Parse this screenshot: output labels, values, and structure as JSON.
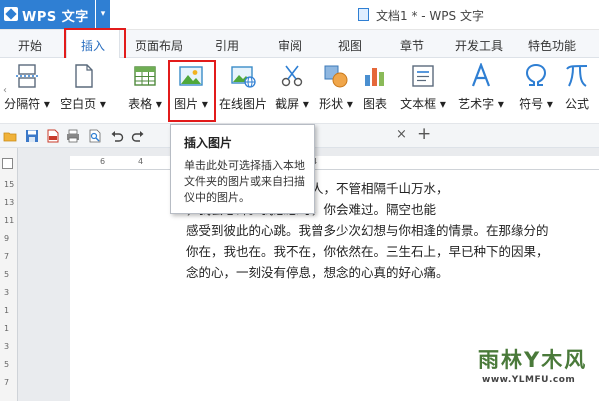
{
  "titlebar": {
    "app_label": "WPS 文字",
    "doc_title": "文档1 * - WPS 文字"
  },
  "menu": {
    "tabs": [
      "开始",
      "插入",
      "页面布局",
      "引用",
      "审阅",
      "视图",
      "章节",
      "开发工具",
      "特色功能"
    ],
    "active": "插入"
  },
  "ribbon": {
    "items": [
      {
        "label": "分隔符 ▾",
        "icon": "separator-icon"
      },
      {
        "label": "空白页 ▾",
        "icon": "blank-page-icon"
      },
      {
        "label": "表格 ▾",
        "icon": "table-icon"
      },
      {
        "label": "图片 ▾",
        "icon": "picture-icon"
      },
      {
        "label": "在线图片",
        "icon": "online-picture-icon"
      },
      {
        "label": "截屏 ▾",
        "icon": "screenshot-icon"
      },
      {
        "label": "形状 ▾",
        "icon": "shape-icon"
      },
      {
        "label": "图表",
        "icon": "chart-icon"
      },
      {
        "label": "文本框 ▾",
        "icon": "textbox-icon"
      },
      {
        "label": "艺术字 ▾",
        "icon": "wordart-icon"
      },
      {
        "label": "符号 ▾",
        "icon": "symbol-icon"
      },
      {
        "label": "公式",
        "icon": "formula-icon"
      }
    ]
  },
  "qat": {
    "tab_close": "×",
    "new_tab": "+"
  },
  "tooltip": {
    "title": "插入图片",
    "body": "单击此处可选择插入本地文件夹的图片或来自扫描仪中的图片。"
  },
  "rulers": {
    "horizontal": [
      "6",
      "4",
      "2",
      "2",
      "4"
    ],
    "vertical": [
      "15",
      "13",
      "11",
      "9",
      "7",
      "5",
      "3",
      "1",
      "1",
      "3",
      "5",
      "7"
    ]
  },
  "document": {
    "paragraph": "样的想念，都说相爱的人，不管相隔千山万水，\n，我会心碎。我思念时，你会难过。隔空也能\n感受到彼此的心跳。我曾多少次幻想与你相逢的情景。在那缘分的\n你在，我也在。我不在，你依然在。三生石上，早已种下的因果，\n念的心，一刻没有停息，想念的心真的好心痛。"
  },
  "watermark": {
    "main": "雨林Y木风",
    "url": "www.YLMFU.com"
  },
  "colors": {
    "accent": "#2f7fd3",
    "highlight_frame": "#e21b1b"
  }
}
